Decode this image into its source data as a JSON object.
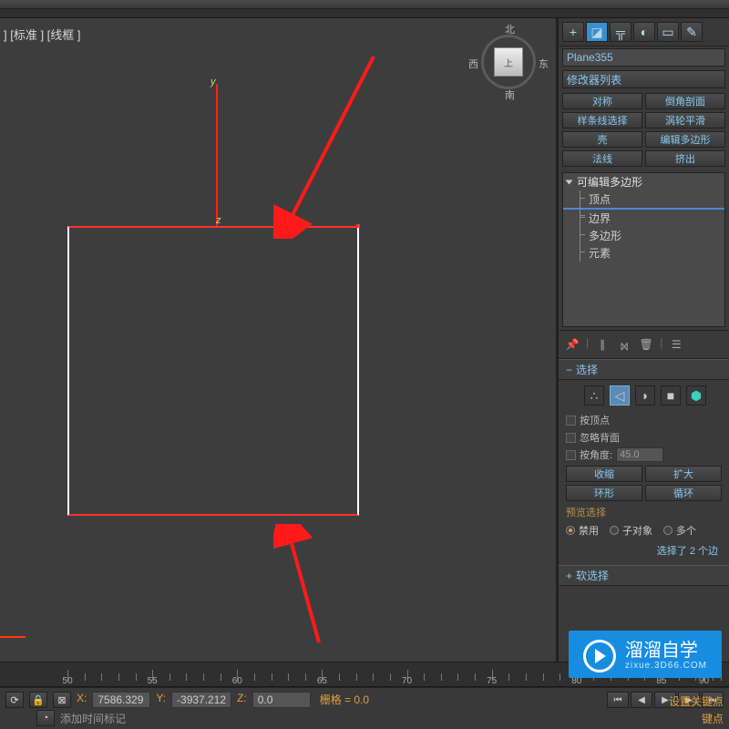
{
  "viewport": {
    "label": "] [标准 ] [线框 ]",
    "axis_y": "y",
    "axis_z": "z",
    "cube": {
      "n": "北",
      "s": "南",
      "w": "西",
      "e": "东",
      "face": "上"
    }
  },
  "side": {
    "object_name": "Plane355",
    "modifier_list_label": "修改器列表",
    "buttons": {
      "symmetry": "对称",
      "chamfer": "倒角剖面",
      "spline_select": "样条线选择",
      "turbosmooth": "涡轮平滑",
      "shell": "壳",
      "edit_poly": "编辑多边形",
      "normal": "法线",
      "extrude": "挤出"
    },
    "stack": {
      "root": "可编辑多边形",
      "vertex": "顶点",
      "edge": "",
      "border": "边界",
      "polygon": "多边形",
      "element": "元素"
    },
    "rollout_select": "选择",
    "by_vertex": "按顶点",
    "ignore_backface": "忽略背面",
    "by_angle": "按角度:",
    "angle_value": "45.0",
    "shrink": "收缩",
    "grow": "扩大",
    "ring": "环形",
    "loop": "循环",
    "preview_sel": "预览选择",
    "disable": "禁用",
    "subobj": "子对象",
    "multi": "多个",
    "selected_info": "选择了 2 个边",
    "rollout_soft": "软选择"
  },
  "ruler": {
    "ticks": [
      {
        "v": 50,
        "p": 8
      },
      {
        "v": 55,
        "p": 20
      },
      {
        "v": 60,
        "p": 32
      },
      {
        "v": 65,
        "p": 44
      },
      {
        "v": 70,
        "p": 56
      },
      {
        "v": 75,
        "p": 68
      },
      {
        "v": 80,
        "p": 80
      },
      {
        "v": 85,
        "p": 92
      },
      {
        "v": 90,
        "p": 98
      }
    ]
  },
  "status": {
    "x_label": "X:",
    "x_value": "7586.329",
    "y_label": "Y:",
    "y_value": "-3937.212",
    "z_label": "Z:",
    "z_value": "0.0",
    "grid_label": "栅格 = 0.0",
    "add_time_tag": "添加时间标记",
    "set_key": "设置关键点",
    "key_pt": "键点"
  },
  "watermark": {
    "title": "溜溜自学",
    "sub": "zixue.3D66.COM"
  }
}
